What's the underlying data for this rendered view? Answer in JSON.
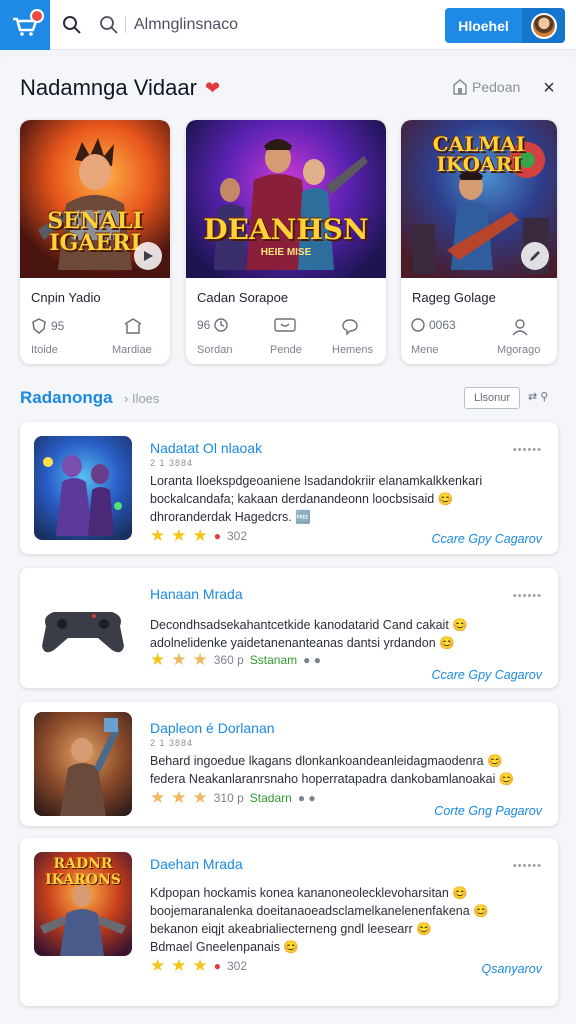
{
  "topbar": {
    "search_placeholder": "Almnglinsnaco",
    "primary_button": "Hloehel",
    "icons": [
      "basket-icon",
      "search-icon",
      "search-icon-alt",
      "avatar"
    ]
  },
  "section": {
    "title": "Nadamnga Vidaar",
    "side_link": "Pedoan",
    "close_glyph": "×"
  },
  "featured": [
    {
      "art_title": "SENALI IGAERI",
      "art_sub": "",
      "title": "Cnpin Yadio",
      "stats": [
        {
          "icon": "shield-icon",
          "value": "95",
          "label": "Itoide"
        },
        {
          "icon": "store-icon",
          "value": "",
          "label": "Mardiae"
        }
      ],
      "accent": "#2e9b2e"
    },
    {
      "art_title": "DEANHSN",
      "art_sub": "HEIE MISE",
      "title": "Cadan Sorapoe",
      "stats": [
        {
          "icon": "clock-icon",
          "value": "96",
          "label": "Sordan"
        },
        {
          "icon": "chat-icon",
          "value": "",
          "label": "Pende"
        },
        {
          "icon": "bubble-icon",
          "value": "",
          "label": "Hemens"
        }
      ]
    },
    {
      "art_title": "CALMAI IKOARI",
      "art_sub": "",
      "title": "Rageg Golage",
      "stats": [
        {
          "icon": "circle-icon",
          "value": "0063",
          "label": "Mene"
        },
        {
          "icon": "user-icon",
          "value": "",
          "label": "Mgorago"
        }
      ]
    }
  ],
  "subsection": {
    "title": "Radanonga",
    "crumb": "Iloes",
    "chip": "Llsonur"
  },
  "list": [
    {
      "title": "Nadatat Ol nlaoak",
      "meta": "2 1 3884",
      "desc": [
        "Loranta Iloekspdgeoaniene lsadandokriir elanamkalkkenkari",
        "bockalcandafa; kakaan derdanandeonn loocbsisaid 😊",
        "dhroranderdak Hagedcrs. 🆓"
      ],
      "rating_text": "302",
      "rating_extra": "",
      "stars": 3,
      "action": "Ccare Gpy Cagarov"
    },
    {
      "title": "Hanaan Mrada",
      "meta": "",
      "desc": [
        "Decondhsadsekahantcetkide kanodatarid Cand cakait 😊",
        "adolnelidenke yaidetanenanteanas dantsi yrdandon 😊"
      ],
      "rating_text": "360 p",
      "rating_extra": "Sstanam",
      "stars": 3,
      "action": "Ccare Gpy Cagarov"
    },
    {
      "title": "Dapleon é Dorlanan",
      "meta": "2 1 3884",
      "desc": [
        "Behard ingoedue lkagans dlonkankoandeanleidagmaodenra 😊",
        "federa Neakanlaranrsnaho hoperratapadra dankobamlanoakai 😊"
      ],
      "rating_text": "310 p",
      "rating_extra": "Stadarn",
      "stars": 3,
      "action": "Corte Gng Pagarov"
    },
    {
      "title": "Daehan Mrada",
      "meta": "",
      "desc": [
        "Kdpopan hockamis konea kananoneolecklevoharsitan 😊",
        "boojemaranalenka doeitanaoeadsclamelkanelenenfakena 😊",
        "bekanon eiqjt akeabrialiecterneng gndl leesearr 😊",
        "Bdmael Gneelenpanais 😊"
      ],
      "rating_text": "302",
      "rating_extra": "",
      "stars": 3,
      "action": "Qsanyarov"
    }
  ],
  "colors": {
    "accent": "#1f8ae6",
    "accent_dark": "#1475cc",
    "link": "#1a8ae0",
    "star": "#f5c518",
    "heart": "#e23b3b"
  }
}
